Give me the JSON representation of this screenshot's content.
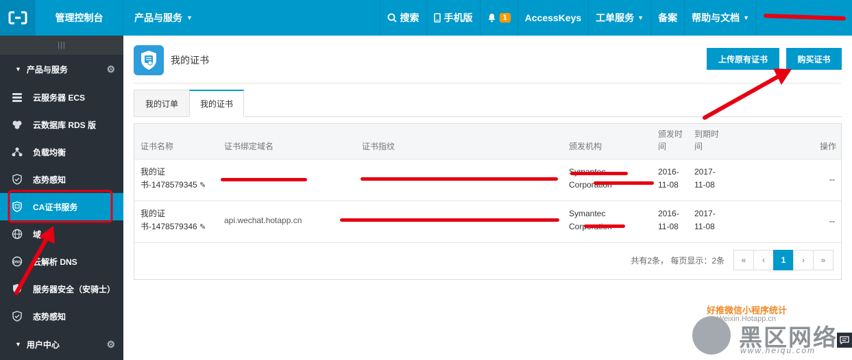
{
  "topbar": {
    "console_title": "管理控制台",
    "products_label": "产品与服务",
    "search_label": "搜索",
    "mobile_label": "手机版",
    "notification_count": "1",
    "accesskeys_label": "AccessKeys",
    "ticket_label": "工单服务",
    "beian_label": "备案",
    "help_label": "帮助与文档"
  },
  "sidebar": {
    "handle": "|||",
    "group_products": "产品与服务",
    "items": [
      {
        "label": "云服务器 ECS"
      },
      {
        "label": "云数据库 RDS 版"
      },
      {
        "label": "负载均衡"
      },
      {
        "label": "态势感知"
      },
      {
        "label": "CA证书服务"
      },
      {
        "label": "域"
      },
      {
        "label": "云解析 DNS"
      },
      {
        "label": "服务器安全（安骑士）"
      },
      {
        "label": "态势感知"
      }
    ],
    "group_user": "用户中心"
  },
  "page": {
    "title": "我的证书",
    "upload_button": "上传原有证书",
    "buy_button": "购买证书"
  },
  "tabs": [
    {
      "label": "我的订单"
    },
    {
      "label": "我的证书"
    }
  ],
  "table": {
    "headers": {
      "name": "证书名称",
      "domain": "证书绑定域名",
      "fingerprint": "证书指纹",
      "issuer": "颁发机构",
      "issue_time": "颁发时间",
      "expire_time": "到期时间",
      "action": "操作"
    },
    "rows": [
      {
        "name_line1": "我的证",
        "name_line2": "书-1478579345",
        "domain": "",
        "fingerprint": "",
        "issuer_line1": "Symantec",
        "issuer_line2": "Corporation",
        "issue_line1": "2016-",
        "issue_line2": "11-08",
        "expire_line1": "2017-",
        "expire_line2": "11-08",
        "action": "--"
      },
      {
        "name_line1": "我的证",
        "name_line2": "书-1478579346",
        "domain": "api.wechat.hotapp.cn",
        "fingerprint": "",
        "issuer_line1": "Symantec",
        "issuer_line2": "Corporation",
        "issue_line1": "2016-",
        "issue_line2": "11-08",
        "expire_line1": "2017-",
        "expire_line2": "11-08",
        "action": "--"
      }
    ]
  },
  "pagination": {
    "summary": "共有2条，  每页显示：2条",
    "first": "«",
    "prev": "‹",
    "current": "1",
    "next": "›",
    "last": "»"
  },
  "watermark": {
    "line1": "好推微信小程序统计",
    "line2": "Weixin.Hotapp.cn",
    "brand": "黑区网络",
    "url": "www.heiqu.com"
  },
  "colors": {
    "primary": "#0099cc",
    "sidebar_bg": "#293038",
    "annotation": "#e60012"
  },
  "icons": {
    "logo": "aliyun-logo-icon",
    "search": "search-icon",
    "mobile": "phone-icon",
    "bell": "bell-icon",
    "gear": "gear-icon",
    "chat": "chat-icon"
  }
}
